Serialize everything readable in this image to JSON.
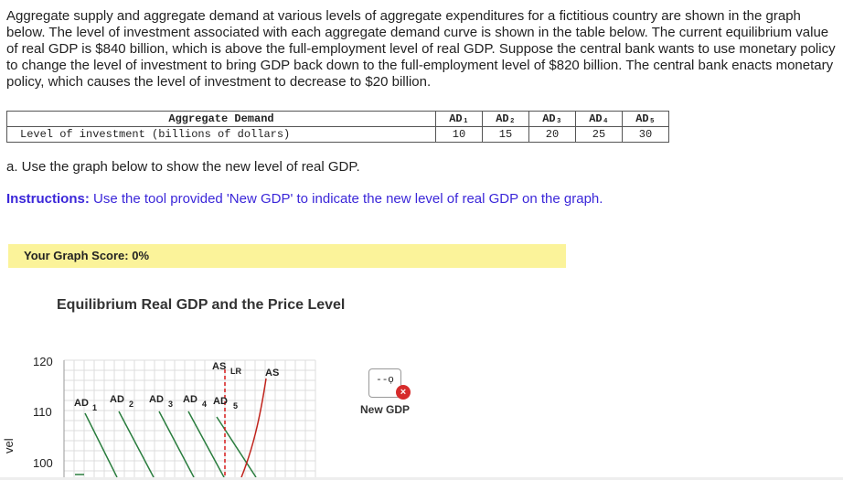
{
  "question": {
    "intro": "Aggregate supply and aggregate demand at various levels of aggregate expenditures for a fictitious country are shown in the graph below. The level of investment associated with each aggregate demand curve is shown in the table below. The current equilibrium value of real GDP is $840 billion, which is above the full-employment level of real GDP. Suppose the central bank wants to use monetary policy to change the level of investment to bring GDP back down to the full-employment level of $820 billion. The central bank enacts monetary policy, which causes the level of investment to decrease to $20 billion.",
    "table": {
      "header_label": "Aggregate Demand",
      "row_label": "Level of investment (billions of dollars)",
      "columns": [
        "AD₁",
        "AD₂",
        "AD₃",
        "AD₄",
        "AD₅"
      ],
      "values": [
        "10",
        "15",
        "20",
        "25",
        "30"
      ]
    },
    "part_a": "a. Use the graph below to show the new level of real GDP.",
    "instructions_bold": "Instructions:",
    "instructions_text": " Use the tool provided 'New GDP' to indicate the new level of real GDP on the graph."
  },
  "score": {
    "label": "Your Graph Score: 0%"
  },
  "graph": {
    "title": "Equilibrium Real GDP and the Price Level",
    "y_axis_label": "vel",
    "y_ticks": [
      "120",
      "110",
      "100"
    ],
    "curve_labels": {
      "ad1": "AD",
      "ad1_sub": "1",
      "ad2": "AD",
      "ad2_sub": "2",
      "ad3": "AD",
      "ad3_sub": "3",
      "ad4": "AD",
      "ad4_sub": "4",
      "ad5": "AD",
      "ad5_sub": "5",
      "aslr": "AS",
      "aslr_sub": "LR",
      "as": "AS"
    },
    "colors": {
      "lras": "#d61a1a",
      "as": "#c0231c",
      "ad": "#2a7d3e",
      "grid": "#dcdcdc"
    }
  },
  "tool": {
    "label": "New GDP",
    "icon": "new-gdp-marker-icon",
    "close_icon": "close-icon"
  }
}
